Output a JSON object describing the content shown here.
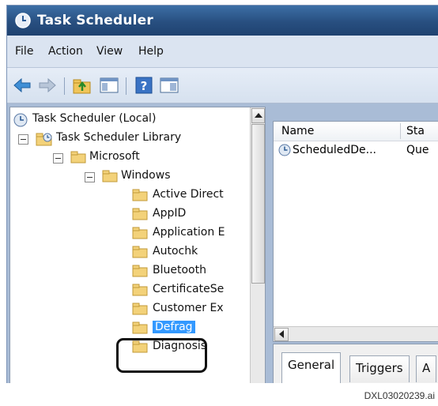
{
  "window": {
    "title": "Task Scheduler"
  },
  "menu": [
    "File",
    "Action",
    "View",
    "Help"
  ],
  "toolbar": {
    "buttons": [
      "back-arrow-icon",
      "forward-arrow-icon",
      "up-folder-icon",
      "show-hide-console-tree-icon",
      "help-icon",
      "show-hide-action-pane-icon"
    ]
  },
  "tree": {
    "root": "Task Scheduler (Local)",
    "library": "Task Scheduler Library",
    "microsoft": "Microsoft",
    "windows": "Windows",
    "children": [
      "Active Direct",
      "AppID",
      "Application E",
      "Autochk",
      "Bluetooth",
      "CertificateSe",
      "Customer Ex",
      "Defrag",
      "Diagnosis"
    ],
    "selected": "Defrag"
  },
  "task_list": {
    "columns": [
      "Name",
      "Sta"
    ],
    "rows": [
      {
        "name": "ScheduledDe...",
        "status": "Que"
      }
    ]
  },
  "detail_tabs": [
    "General",
    "Triggers",
    "A"
  ],
  "caption": "DXL03020239.ai",
  "colors": {
    "titlebar": "#284f80",
    "frame": "#a9bcd6",
    "selection": "#3399ff",
    "folder": "#f3d27a",
    "callout": "#111111"
  }
}
